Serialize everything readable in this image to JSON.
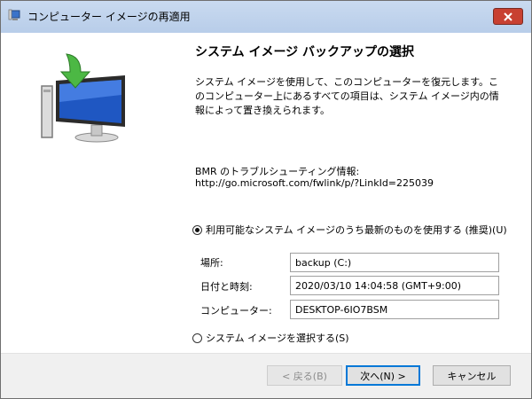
{
  "window": {
    "title": "コンピューター イメージの再適用",
    "close_label": "✕"
  },
  "main": {
    "heading": "システム イメージ バックアップの選択",
    "description": "システム イメージを使用して、このコンピューターを復元します。このコンピューター上にあるすべての項目は、システム イメージ内の情報によって置き換えられます。",
    "bmr_label": "BMR のトラブルシューティング情報:",
    "bmr_link": "http://go.microsoft.com/fwlink/p/?LinkId=225039"
  },
  "options": {
    "use_latest_label": "利用可能なシステム イメージのうち最新のものを使用する (推奨)(U)",
    "use_latest_selected": true,
    "select_image_label": "システム イメージを選択する(S)",
    "select_image_selected": false
  },
  "details": {
    "location_label": "場所:",
    "location_value": "backup (C:)",
    "datetime_label": "日付と時刻:",
    "datetime_value": "2020/03/10 14:04:58 (GMT+9:00)",
    "computer_label": "コンピューター:",
    "computer_value": "DESKTOP-6IO7BSM"
  },
  "buttons": {
    "back": "< 戻る(B)",
    "next": "次へ(N) >",
    "cancel": "キャンセル"
  },
  "colors": {
    "titlebar": "#c0d4ee",
    "close": "#c84031",
    "primary_border": "#0078d7"
  }
}
